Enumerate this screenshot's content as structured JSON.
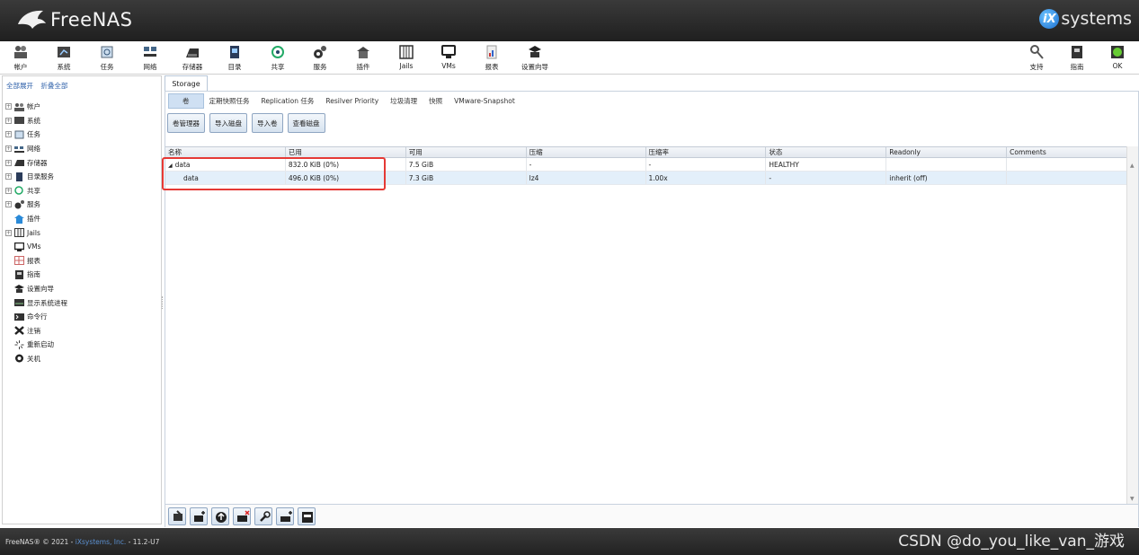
{
  "header": {
    "brand": "FreeNAS",
    "vendor": "systems",
    "vendor_mark": "iX"
  },
  "toolbar": {
    "left": [
      {
        "label": "帐户",
        "icon": "users-icon"
      },
      {
        "label": "系统",
        "icon": "system-icon"
      },
      {
        "label": "任务",
        "icon": "tasks-icon"
      },
      {
        "label": "网络",
        "icon": "network-icon"
      },
      {
        "label": "存储器",
        "icon": "storage-icon"
      },
      {
        "label": "目录",
        "icon": "directory-icon"
      },
      {
        "label": "共享",
        "icon": "sharing-icon"
      },
      {
        "label": "服务",
        "icon": "services-icon"
      },
      {
        "label": "插件",
        "icon": "plugins-icon"
      },
      {
        "label": "Jails",
        "icon": "jails-icon"
      },
      {
        "label": "VMs",
        "icon": "vms-icon"
      },
      {
        "label": "报表",
        "icon": "reports-icon"
      },
      {
        "label": "设置向导",
        "icon": "wizard-icon"
      }
    ],
    "right": [
      {
        "label": "支持",
        "icon": "support-icon"
      },
      {
        "label": "指南",
        "icon": "guide-icon"
      },
      {
        "label": "OK",
        "icon": "alert-ok-icon"
      }
    ]
  },
  "tree": {
    "expand_all": "全部展开",
    "collapse_all": "折叠全部",
    "items": [
      {
        "label": "帐户",
        "expandable": true
      },
      {
        "label": "系统",
        "expandable": true
      },
      {
        "label": "任务",
        "expandable": true
      },
      {
        "label": "网络",
        "expandable": true
      },
      {
        "label": "存储器",
        "expandable": true
      },
      {
        "label": "目录服务",
        "expandable": true
      },
      {
        "label": "共享",
        "expandable": true
      },
      {
        "label": "服务",
        "expandable": true
      },
      {
        "label": "插件",
        "expandable": false
      },
      {
        "label": "Jails",
        "expandable": true
      },
      {
        "label": "VMs",
        "expandable": false
      },
      {
        "label": "报表",
        "expandable": false
      },
      {
        "label": "指南",
        "expandable": false
      },
      {
        "label": "设置向导",
        "expandable": false
      },
      {
        "label": "显示系统进程",
        "expandable": false
      },
      {
        "label": "命令行",
        "expandable": false
      },
      {
        "label": "注销",
        "expandable": false
      },
      {
        "label": "重新启动",
        "expandable": false
      },
      {
        "label": "关机",
        "expandable": false
      }
    ]
  },
  "main": {
    "tab": "Storage",
    "subtabs": [
      "卷",
      "定期快照任务",
      "Replication 任务",
      "Resilver Priority",
      "垃圾清理",
      "快照",
      "VMware-Snapshot"
    ],
    "buttons": [
      "卷管理器",
      "导入磁盘",
      "导入卷",
      "查看磁盘"
    ],
    "columns": [
      "名称",
      "已用",
      "可用",
      "压缩",
      "压缩率",
      "状态",
      "Readonly",
      "Comments"
    ],
    "rows": [
      {
        "name": "data",
        "used": "832.0 KiB (0%)",
        "avail": "7.5 GiB",
        "compression": "-",
        "ratio": "-",
        "status": "HEALTHY",
        "readonly": "",
        "comments": ""
      },
      {
        "name": "data",
        "used": "496.0 KiB (0%)",
        "avail": "7.3 GiB",
        "compression": "lz4",
        "ratio": "1.00x",
        "status": "-",
        "readonly": "inherit (off)",
        "comments": ""
      }
    ]
  },
  "footer": {
    "copyright_prefix": "FreeNAS® © 2021 - ",
    "vendor": "iXsystems, Inc.",
    "version_suffix": " - 11.2-U7",
    "watermark": "CSDN @do_you_like_van_游戏"
  },
  "colors": {
    "accent": "#cfe0f3",
    "highlight": "#e53935",
    "header_bg": "#2a2a2a"
  }
}
